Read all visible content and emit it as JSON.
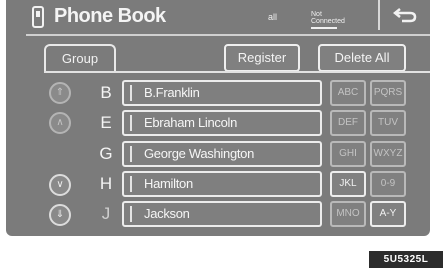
{
  "header": {
    "title": "Phone Book",
    "signal_label": "all",
    "status_top": "Not",
    "status_bottom": "Connected",
    "back_icon": "return-arrow-icon"
  },
  "tabs": {
    "group_label": "Group"
  },
  "toolbar": {
    "register_label": "Register",
    "delete_all_label": "Delete All"
  },
  "scroll": {
    "page_up_label": "⇑",
    "up_label": "∧",
    "down_label": "∨",
    "page_down_label": "⇓"
  },
  "contacts": [
    {
      "letter": "B",
      "name": "B.Franklin"
    },
    {
      "letter": "E",
      "name": "Ebraham Lincoln"
    },
    {
      "letter": "G",
      "name": "George Washington"
    },
    {
      "letter": "H",
      "name": "Hamilton"
    },
    {
      "letter": "J",
      "name": "Jackson"
    }
  ],
  "alphabet": [
    {
      "label": "ABC",
      "active": false
    },
    {
      "label": "PQRS",
      "active": false
    },
    {
      "label": "DEF",
      "active": false
    },
    {
      "label": "TUV",
      "active": false
    },
    {
      "label": "GHI",
      "active": false
    },
    {
      "label": "WXYZ",
      "active": false
    },
    {
      "label": "JKL",
      "active": true
    },
    {
      "label": "0-9",
      "active": false
    },
    {
      "label": "MNO",
      "active": false
    },
    {
      "label": "A-Y",
      "active": true
    }
  ],
  "caption": "5U5325L"
}
